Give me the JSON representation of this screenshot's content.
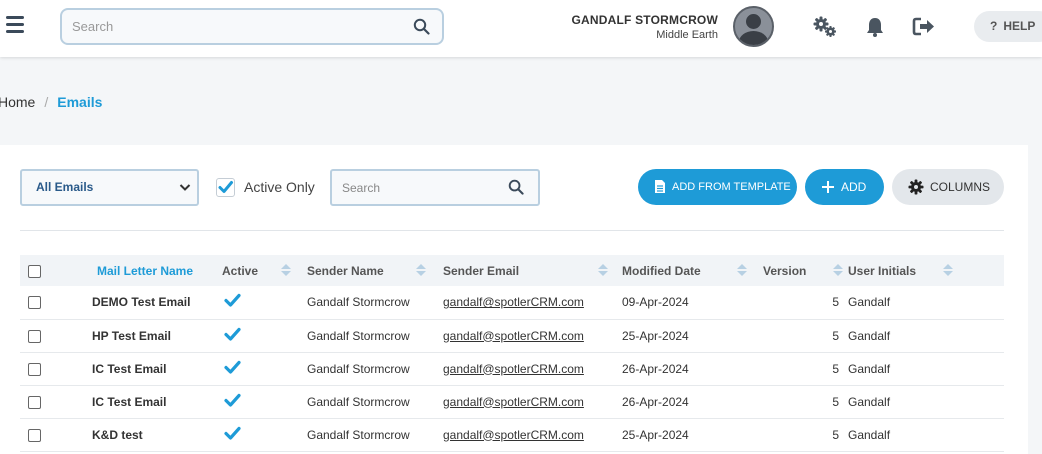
{
  "header": {
    "search_placeholder": "Search",
    "user_name": "GANDALF STORMCROW",
    "user_location": "Middle Earth",
    "help_label": "HELP",
    "help_glyph": "?"
  },
  "breadcrumb": {
    "home": "Home",
    "separator": "/",
    "current": "Emails"
  },
  "toolbar": {
    "filter_selected": "All Emails",
    "active_only_label": "Active Only",
    "active_only_checked": true,
    "search_placeholder": "Search",
    "add_from_template_label": "ADD FROM TEMPLATE",
    "add_label": "ADD",
    "columns_label": "COLUMNS"
  },
  "table": {
    "columns": [
      "Mail Letter Name",
      "Active",
      "Sender Name",
      "Sender Email",
      "Modified Date",
      "Version",
      "User Initials"
    ],
    "rows": [
      {
        "name": "DEMO Test Email",
        "active": true,
        "sender_name": "Gandalf Stormcrow",
        "sender_email": "gandalf@spotlerCRM.com",
        "modified": "09-Apr-2024",
        "version": "5",
        "initials": "Gandalf"
      },
      {
        "name": "HP Test Email",
        "active": true,
        "sender_name": "Gandalf Stormcrow",
        "sender_email": "gandalf@spotlerCRM.com",
        "modified": "25-Apr-2024",
        "version": "5",
        "initials": "Gandalf"
      },
      {
        "name": "IC Test Email",
        "active": true,
        "sender_name": "Gandalf Stormcrow",
        "sender_email": "gandalf@spotlerCRM.com",
        "modified": "26-Apr-2024",
        "version": "5",
        "initials": "Gandalf"
      },
      {
        "name": "IC Test Email",
        "active": true,
        "sender_name": "Gandalf Stormcrow",
        "sender_email": "gandalf@spotlerCRM.com",
        "modified": "26-Apr-2024",
        "version": "5",
        "initials": "Gandalf"
      },
      {
        "name": "K&D test",
        "active": true,
        "sender_name": "Gandalf Stormcrow",
        "sender_email": "gandalf@spotlerCRM.com",
        "modified": "25-Apr-2024",
        "version": "5",
        "initials": "Gandalf"
      }
    ]
  },
  "colors": {
    "accent": "#1e9bd7",
    "topbar_bg": "#ffffff",
    "page_bg": "#f4f6f8"
  },
  "icons": [
    "hamburger-icon",
    "search-icon",
    "avatar",
    "settings-cogs-icon",
    "bell-icon",
    "logout-icon",
    "question-icon",
    "chevron-down-icon",
    "check-icon",
    "document-icon",
    "plus-icon",
    "gear-icon",
    "sort-icon"
  ]
}
